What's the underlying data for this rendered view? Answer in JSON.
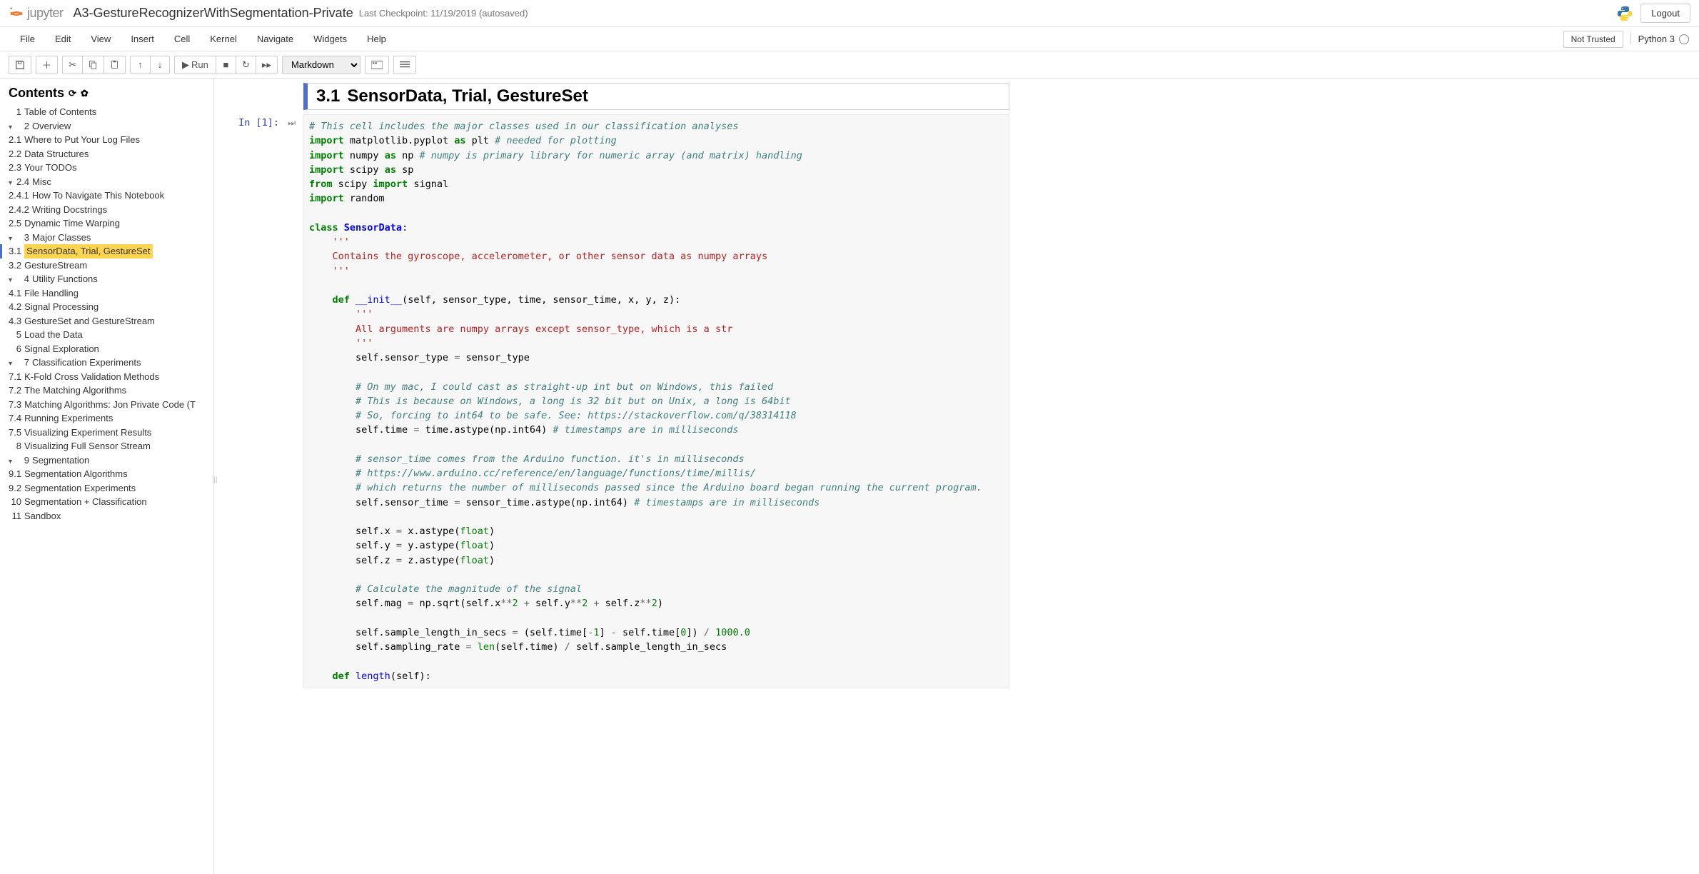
{
  "header": {
    "logo_text": "jupyter",
    "notebook_title": "A3-GestureRecognizerWithSegmentation-Private",
    "checkpoint": "Last Checkpoint: 11/19/2019  (autosaved)",
    "logout": "Logout"
  },
  "menubar": {
    "items": [
      "File",
      "Edit",
      "View",
      "Insert",
      "Cell",
      "Kernel",
      "Navigate",
      "Widgets",
      "Help"
    ],
    "trust": "Not Trusted",
    "kernel": "Python 3"
  },
  "toolbar": {
    "run_label": "Run",
    "cell_type": "Markdown"
  },
  "toc": {
    "title": "Contents",
    "items": [
      {
        "level": 1,
        "num": "1",
        "label": "Table of Contents",
        "arrow": ""
      },
      {
        "level": 1,
        "num": "2",
        "label": "Overview",
        "arrow": "▾"
      },
      {
        "level": 2,
        "num": "2.1",
        "label": "Where to Put Your Log Files",
        "arrow": ""
      },
      {
        "level": 2,
        "num": "2.2",
        "label": "Data Structures",
        "arrow": ""
      },
      {
        "level": 2,
        "num": "2.3",
        "label": "Your TODOs",
        "arrow": ""
      },
      {
        "level": 2,
        "num": "2.4",
        "label": "Misc",
        "arrow": "▾"
      },
      {
        "level": 3,
        "num": "2.4.1",
        "label": "How To Navigate This Notebook",
        "arrow": ""
      },
      {
        "level": 3,
        "num": "2.4.2",
        "label": "Writing Docstrings",
        "arrow": ""
      },
      {
        "level": 2,
        "num": "2.5",
        "label": "Dynamic Time Warping",
        "arrow": ""
      },
      {
        "level": 1,
        "num": "3",
        "label": "Major Classes",
        "arrow": "▾"
      },
      {
        "level": 2,
        "num": "3.1",
        "label": "SensorData, Trial, GestureSet",
        "arrow": "",
        "active": true
      },
      {
        "level": 2,
        "num": "3.2",
        "label": "GestureStream",
        "arrow": ""
      },
      {
        "level": 1,
        "num": "4",
        "label": "Utility Functions",
        "arrow": "▾"
      },
      {
        "level": 2,
        "num": "4.1",
        "label": "File Handling",
        "arrow": ""
      },
      {
        "level": 2,
        "num": "4.2",
        "label": "Signal Processing",
        "arrow": ""
      },
      {
        "level": 2,
        "num": "4.3",
        "label": "GestureSet and GestureStream",
        "arrow": ""
      },
      {
        "level": 1,
        "num": "5",
        "label": "Load the Data",
        "arrow": ""
      },
      {
        "level": 1,
        "num": "6",
        "label": "Signal Exploration",
        "arrow": ""
      },
      {
        "level": 1,
        "num": "7",
        "label": "Classification Experiments",
        "arrow": "▾"
      },
      {
        "level": 2,
        "num": "7.1",
        "label": "K-Fold Cross Validation Methods",
        "arrow": ""
      },
      {
        "level": 2,
        "num": "7.2",
        "label": "The Matching Algorithms",
        "arrow": ""
      },
      {
        "level": 2,
        "num": "7.3",
        "label": "Matching Algorithms: Jon Private Code (T",
        "arrow": ""
      },
      {
        "level": 2,
        "num": "7.4",
        "label": "Running Experiments",
        "arrow": ""
      },
      {
        "level": 2,
        "num": "7.5",
        "label": "Visualizing Experiment Results",
        "arrow": ""
      },
      {
        "level": 1,
        "num": "8",
        "label": "Visualizing Full Sensor Stream",
        "arrow": ""
      },
      {
        "level": 1,
        "num": "9",
        "label": "Segmentation",
        "arrow": "▾"
      },
      {
        "level": 2,
        "num": "9.1",
        "label": "Segmentation Algorithms",
        "arrow": ""
      },
      {
        "level": 2,
        "num": "9.2",
        "label": "Segmentation Experiments",
        "arrow": ""
      },
      {
        "level": 1,
        "num": "10",
        "label": "Segmentation + Classification",
        "arrow": ""
      },
      {
        "level": 1,
        "num": "11",
        "label": "Sandbox",
        "arrow": ""
      }
    ]
  },
  "cells": {
    "heading": {
      "num": "3.1",
      "title": "SensorData, Trial, GestureSet"
    },
    "code": {
      "prompt": "In [1]:",
      "lines": [
        {
          "t": "c",
          "text": "# This cell includes the major classes used in our classification analyses"
        },
        {
          "segments": [
            {
              "t": "k",
              "text": "import"
            },
            {
              "t": "",
              "text": " matplotlib.pyplot "
            },
            {
              "t": "k",
              "text": "as"
            },
            {
              "t": "",
              "text": " plt "
            },
            {
              "t": "c",
              "text": "# needed for plotting"
            }
          ]
        },
        {
          "segments": [
            {
              "t": "k",
              "text": "import"
            },
            {
              "t": "",
              "text": " numpy "
            },
            {
              "t": "k",
              "text": "as"
            },
            {
              "t": "",
              "text": " np "
            },
            {
              "t": "c",
              "text": "# numpy is primary library for numeric array (and matrix) handling"
            }
          ]
        },
        {
          "segments": [
            {
              "t": "k",
              "text": "import"
            },
            {
              "t": "",
              "text": " scipy "
            },
            {
              "t": "k",
              "text": "as"
            },
            {
              "t": "",
              "text": " sp"
            }
          ]
        },
        {
          "segments": [
            {
              "t": "k",
              "text": "from"
            },
            {
              "t": "",
              "text": " scipy "
            },
            {
              "t": "k",
              "text": "import"
            },
            {
              "t": "",
              "text": " signal"
            }
          ]
        },
        {
          "segments": [
            {
              "t": "k",
              "text": "import"
            },
            {
              "t": "",
              "text": " random"
            }
          ]
        },
        {
          "t": "",
          "text": ""
        },
        {
          "segments": [
            {
              "t": "k",
              "text": "class"
            },
            {
              "t": "",
              "text": " "
            },
            {
              "t": "nn",
              "text": "SensorData"
            },
            {
              "t": "",
              "text": ":"
            }
          ]
        },
        {
          "t": "s",
          "text": "    '''"
        },
        {
          "t": "s",
          "text": "    Contains the gyroscope, accelerometer, or other sensor data as numpy arrays"
        },
        {
          "t": "s",
          "text": "    '''"
        },
        {
          "t": "",
          "text": ""
        },
        {
          "segments": [
            {
              "t": "",
              "text": "    "
            },
            {
              "t": "k",
              "text": "def"
            },
            {
              "t": "",
              "text": " "
            },
            {
              "t": "fm",
              "text": "__init__"
            },
            {
              "t": "",
              "text": "(self, sensor_type, time, sensor_time, x, y, z):"
            }
          ]
        },
        {
          "t": "s",
          "text": "        '''"
        },
        {
          "t": "s",
          "text": "        All arguments are numpy arrays except sensor_type, which is a str"
        },
        {
          "t": "s",
          "text": "        '''"
        },
        {
          "segments": [
            {
              "t": "",
              "text": "        self.sensor_type "
            },
            {
              "t": "o",
              "text": "="
            },
            {
              "t": "",
              "text": " sensor_type"
            }
          ]
        },
        {
          "t": "",
          "text": ""
        },
        {
          "t": "c",
          "text": "        # On my mac, I could cast as straight-up int but on Windows, this failed"
        },
        {
          "t": "c",
          "text": "        # This is because on Windows, a long is 32 bit but on Unix, a long is 64bit"
        },
        {
          "t": "c",
          "text": "        # So, forcing to int64 to be safe. See: https://stackoverflow.com/q/38314118"
        },
        {
          "segments": [
            {
              "t": "",
              "text": "        self.time "
            },
            {
              "t": "o",
              "text": "="
            },
            {
              "t": "",
              "text": " time.astype(np.int64) "
            },
            {
              "t": "c",
              "text": "# timestamps are in milliseconds"
            }
          ]
        },
        {
          "t": "",
          "text": ""
        },
        {
          "t": "c",
          "text": "        # sensor_time comes from the Arduino function. it's in milliseconds"
        },
        {
          "t": "c",
          "text": "        # https://www.arduino.cc/reference/en/language/functions/time/millis/"
        },
        {
          "t": "c",
          "text": "        # which returns the number of milliseconds passed since the Arduino board began running the current program."
        },
        {
          "segments": [
            {
              "t": "",
              "text": "        self.sensor_time "
            },
            {
              "t": "o",
              "text": "="
            },
            {
              "t": "",
              "text": " sensor_time.astype(np.int64) "
            },
            {
              "t": "c",
              "text": "# timestamps are in milliseconds"
            }
          ]
        },
        {
          "t": "",
          "text": ""
        },
        {
          "segments": [
            {
              "t": "",
              "text": "        self.x "
            },
            {
              "t": "o",
              "text": "="
            },
            {
              "t": "",
              "text": " x.astype("
            },
            {
              "t": "nb",
              "text": "float"
            },
            {
              "t": "",
              "text": ")"
            }
          ]
        },
        {
          "segments": [
            {
              "t": "",
              "text": "        self.y "
            },
            {
              "t": "o",
              "text": "="
            },
            {
              "t": "",
              "text": " y.astype("
            },
            {
              "t": "nb",
              "text": "float"
            },
            {
              "t": "",
              "text": ")"
            }
          ]
        },
        {
          "segments": [
            {
              "t": "",
              "text": "        self.z "
            },
            {
              "t": "o",
              "text": "="
            },
            {
              "t": "",
              "text": " z.astype("
            },
            {
              "t": "nb",
              "text": "float"
            },
            {
              "t": "",
              "text": ")"
            }
          ]
        },
        {
          "t": "",
          "text": ""
        },
        {
          "t": "c",
          "text": "        # Calculate the magnitude of the signal"
        },
        {
          "segments": [
            {
              "t": "",
              "text": "        self.mag "
            },
            {
              "t": "o",
              "text": "="
            },
            {
              "t": "",
              "text": " np.sqrt(self.x"
            },
            {
              "t": "o",
              "text": "**"
            },
            {
              "t": "mi",
              "text": "2"
            },
            {
              "t": "",
              "text": " "
            },
            {
              "t": "o",
              "text": "+"
            },
            {
              "t": "",
              "text": " self.y"
            },
            {
              "t": "o",
              "text": "**"
            },
            {
              "t": "mi",
              "text": "2"
            },
            {
              "t": "",
              "text": " "
            },
            {
              "t": "o",
              "text": "+"
            },
            {
              "t": "",
              "text": " self.z"
            },
            {
              "t": "o",
              "text": "**"
            },
            {
              "t": "mi",
              "text": "2"
            },
            {
              "t": "",
              "text": ")"
            }
          ]
        },
        {
          "t": "",
          "text": ""
        },
        {
          "segments": [
            {
              "t": "",
              "text": "        self.sample_length_in_secs "
            },
            {
              "t": "o",
              "text": "="
            },
            {
              "t": "",
              "text": " (self.time["
            },
            {
              "t": "o",
              "text": "-"
            },
            {
              "t": "mi",
              "text": "1"
            },
            {
              "t": "",
              "text": "] "
            },
            {
              "t": "o",
              "text": "-"
            },
            {
              "t": "",
              "text": " self.time["
            },
            {
              "t": "mi",
              "text": "0"
            },
            {
              "t": "",
              "text": "]) "
            },
            {
              "t": "o",
              "text": "/"
            },
            {
              "t": "",
              "text": " "
            },
            {
              "t": "mi",
              "text": "1000.0"
            }
          ]
        },
        {
          "segments": [
            {
              "t": "",
              "text": "        self.sampling_rate "
            },
            {
              "t": "o",
              "text": "="
            },
            {
              "t": "",
              "text": " "
            },
            {
              "t": "nb",
              "text": "len"
            },
            {
              "t": "",
              "text": "(self.time) "
            },
            {
              "t": "o",
              "text": "/"
            },
            {
              "t": "",
              "text": " self.sample_length_in_secs"
            }
          ]
        },
        {
          "t": "",
          "text": ""
        },
        {
          "segments": [
            {
              "t": "",
              "text": "    "
            },
            {
              "t": "k",
              "text": "def"
            },
            {
              "t": "",
              "text": " "
            },
            {
              "t": "nf",
              "text": "length"
            },
            {
              "t": "",
              "text": "(self):"
            }
          ]
        }
      ]
    }
  }
}
